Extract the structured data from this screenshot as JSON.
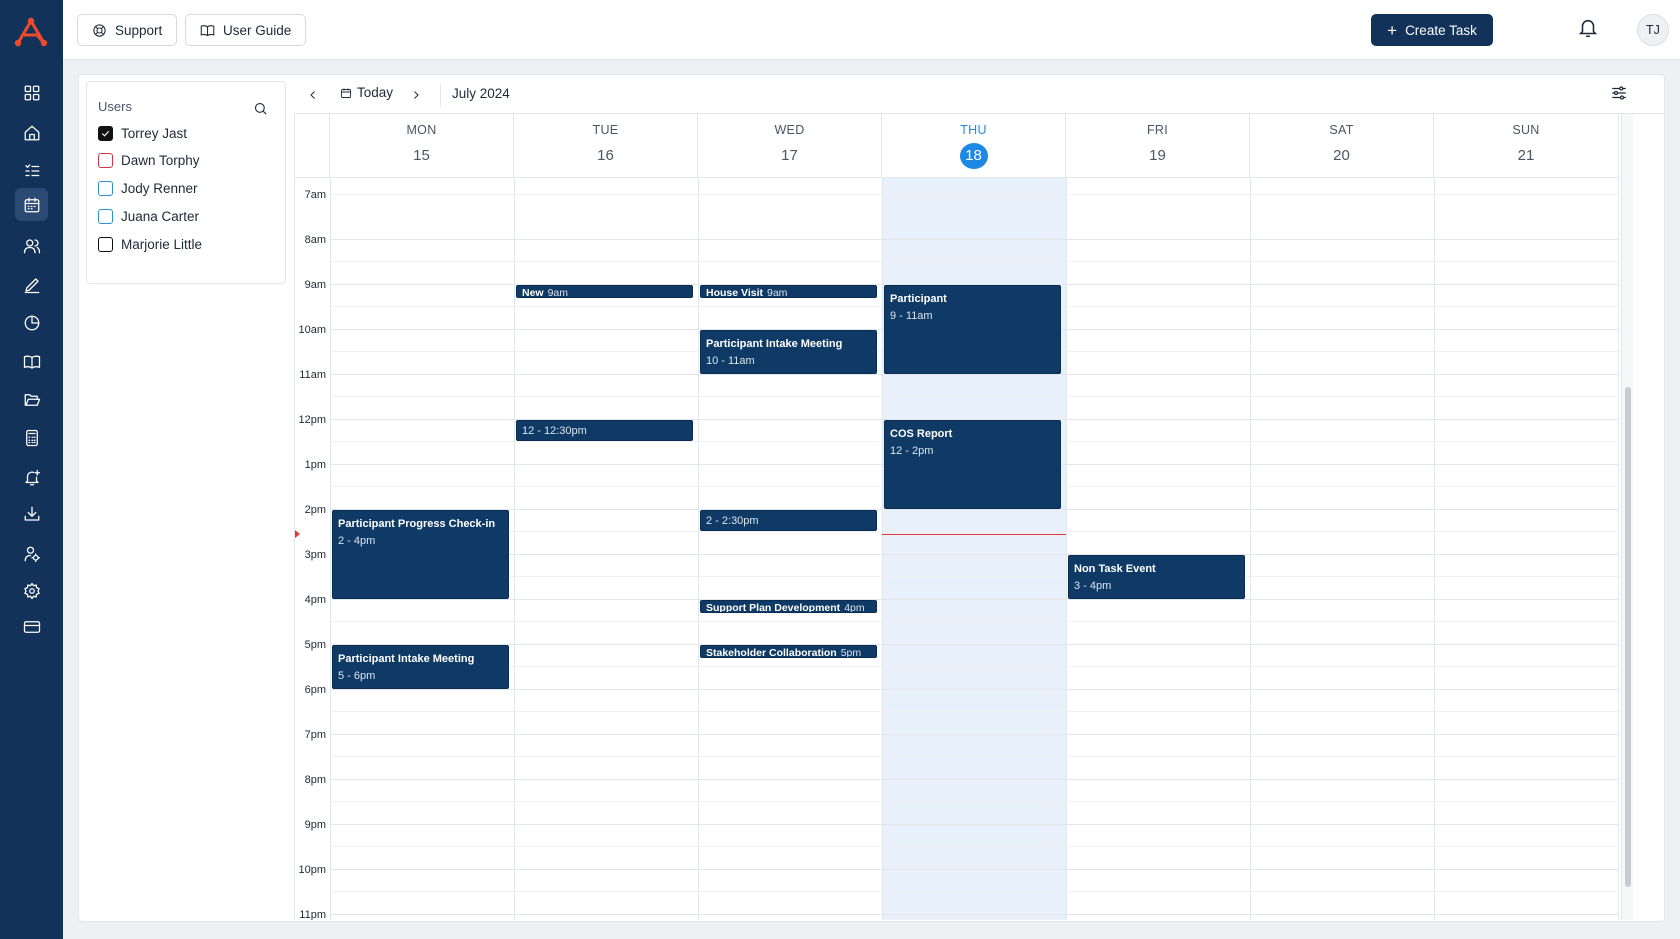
{
  "app": {
    "topbar": {
      "support_label": "Support",
      "user_guide_label": "User Guide",
      "create_task_label": "Create Task",
      "avatar_initials": "TJ"
    },
    "sidebar": {
      "items": [
        {
          "icon": "dashboard-icon"
        },
        {
          "icon": "home-icon"
        },
        {
          "icon": "task-list-icon"
        },
        {
          "icon": "calendar-icon",
          "active": true
        },
        {
          "icon": "users-icon"
        },
        {
          "icon": "pen-icon"
        },
        {
          "icon": "pie-chart-icon"
        },
        {
          "icon": "book-icon"
        },
        {
          "icon": "folder-icon"
        },
        {
          "icon": "calculator-icon"
        },
        {
          "icon": "bell-plus-icon"
        },
        {
          "icon": "download-icon"
        },
        {
          "icon": "user-settings-icon"
        },
        {
          "icon": "gear-icon"
        },
        {
          "icon": "credit-card-icon"
        }
      ]
    }
  },
  "users_panel": {
    "title": "Users",
    "users": [
      {
        "name": "Torrey Jast",
        "checked": true,
        "color": "#111111"
      },
      {
        "name": "Dawn Torphy",
        "checked": false,
        "color": "#d0344b"
      },
      {
        "name": "Jody Renner",
        "checked": false,
        "color": "#2f8fd0"
      },
      {
        "name": "Juana Carter",
        "checked": false,
        "color": "#2f8fd0"
      },
      {
        "name": "Marjorie Little",
        "checked": false,
        "color": "#111111"
      }
    ]
  },
  "calendar": {
    "today_label": "Today",
    "month_label": "July 2024",
    "days": [
      {
        "name": "MON",
        "num": "15"
      },
      {
        "name": "TUE",
        "num": "16"
      },
      {
        "name": "WED",
        "num": "17"
      },
      {
        "name": "THU",
        "num": "18",
        "today": true
      },
      {
        "name": "FRI",
        "num": "19"
      },
      {
        "name": "SAT",
        "num": "20"
      },
      {
        "name": "SUN",
        "num": "21"
      }
    ],
    "hours": [
      "7am",
      "8am",
      "9am",
      "10am",
      "11am",
      "12pm",
      "1pm",
      "2pm",
      "3pm",
      "4pm",
      "5pm",
      "6pm",
      "7pm",
      "8pm",
      "9pm",
      "10pm",
      "11pm"
    ],
    "events": {
      "mon_1": {
        "title": "Participant Progress Check-in",
        "time": "2 - 4pm"
      },
      "mon_2": {
        "title": "Participant Intake Meeting",
        "time": "5 - 6pm"
      },
      "tue_1": {
        "title": "New",
        "time": "9am"
      },
      "tue_2": {
        "title": "",
        "time": "12 - 12:30pm"
      },
      "wed_1": {
        "title": "House Visit",
        "time": "9am"
      },
      "wed_2": {
        "title": "Participant Intake Meeting",
        "time": "10 - 11am"
      },
      "wed_3": {
        "title": "",
        "time": "2 - 2:30pm"
      },
      "wed_4": {
        "title": "Support Plan Development",
        "time": "4pm"
      },
      "wed_5": {
        "title": "Stakeholder Collaboration",
        "time": "5pm"
      },
      "thu_1": {
        "title": "Participant",
        "time": "9 - 11am"
      },
      "thu_2": {
        "title": "COS Report",
        "time": "12 - 2pm"
      },
      "fri_1": {
        "title": "Non Task Event",
        "time": "3 - 4pm"
      }
    }
  }
}
